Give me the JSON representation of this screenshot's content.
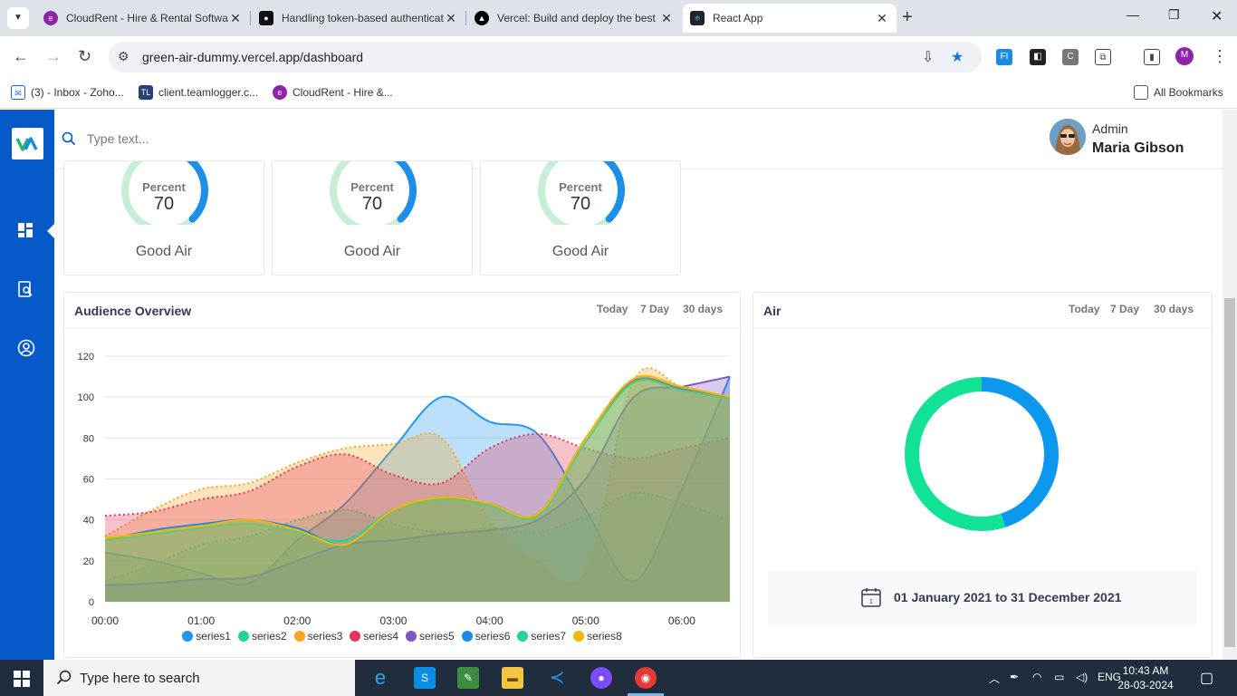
{
  "browser": {
    "tabs": [
      {
        "title": "CloudRent - Hire & Rental Software",
        "color": "#8e24aa"
      },
      {
        "title": "Handling token-based authentication",
        "color": "#111111"
      },
      {
        "title": "Vercel: Build and deploy the best",
        "color": "#000000"
      },
      {
        "title": "React App",
        "color": "#20232a"
      }
    ],
    "url": "green-air-dummy.vercel.app/dashboard",
    "bookmarks": [
      {
        "label": "(3) - Inbox - Zoho..."
      },
      {
        "label": "client.teamlogger.c..."
      },
      {
        "label": "CloudRent - Hire &..."
      }
    ],
    "all_bookmarks": "All Bookmarks",
    "profile_initial": "M"
  },
  "app": {
    "search_placeholder": "Type text...",
    "user": {
      "role": "Admin",
      "name": "Maria Gibson"
    },
    "gauges": [
      {
        "sub": "Percent",
        "value": "70",
        "label": "Good Air",
        "percent": 70
      },
      {
        "sub": "Percent",
        "value": "70",
        "label": "Good Air",
        "percent": 70
      },
      {
        "sub": "Percent",
        "value": "70",
        "label": "Good Air",
        "percent": 70
      }
    ],
    "audience": {
      "title": "Audience Overview",
      "ranges": [
        "Today",
        "7 Day",
        "30 days"
      ]
    },
    "air": {
      "title": "Air",
      "ranges": [
        "Today",
        "7 Day",
        "30 days"
      ],
      "date_range": "01 January 2021 to 31 December 2021"
    }
  },
  "chart_data": [
    {
      "type": "area",
      "ylim": [
        0,
        120
      ],
      "yticks": [
        "0",
        "20",
        "40",
        "60",
        "80",
        "100",
        "120"
      ],
      "xticks": [
        "00:00",
        "01:00",
        "02:00",
        "03:00",
        "04:00",
        "05:00",
        "06:00"
      ],
      "x": [
        0,
        0.5,
        1,
        1.5,
        2,
        2.5,
        3,
        3.5,
        4,
        4.5,
        5,
        5.5,
        6,
        6.5
      ],
      "series": [
        {
          "name": "series1",
          "color": "#2196f3",
          "dashed": false,
          "values": [
            24,
            20,
            14,
            9,
            30,
            48,
            75,
            100,
            88,
            82,
            45,
            10,
            55,
            110
          ]
        },
        {
          "name": "series2",
          "color": "#1ed68f",
          "dashed": true,
          "values": [
            10,
            18,
            28,
            32,
            40,
            45,
            38,
            34,
            36,
            34,
            42,
            53,
            48,
            40
          ]
        },
        {
          "name": "series3",
          "color": "#f5a623",
          "dashed": true,
          "values": [
            32,
            45,
            55,
            58,
            68,
            75,
            77,
            80,
            40,
            20,
            15,
            108,
            105,
            100
          ]
        },
        {
          "name": "series4",
          "color": "#e8345a",
          "dashed": true,
          "values": [
            42,
            44,
            50,
            54,
            66,
            72,
            62,
            58,
            75,
            82,
            75,
            70,
            75,
            80
          ]
        },
        {
          "name": "series5",
          "color": "#7e57c2",
          "dashed": false,
          "values": [
            8,
            9,
            11,
            12,
            20,
            28,
            30,
            33,
            35,
            40,
            60,
            100,
            105,
            110
          ]
        },
        {
          "name": "series6",
          "color": "#1e88e5",
          "dashed": false,
          "values": [
            30,
            35,
            38,
            40,
            36,
            28,
            45,
            50,
            48,
            43,
            80,
            108,
            104,
            100
          ]
        },
        {
          "name": "series7",
          "color": "#26d3a0",
          "dashed": false,
          "values": [
            30,
            33,
            36,
            38,
            34,
            30,
            45,
            50,
            47,
            42,
            78,
            107,
            103,
            99
          ]
        },
        {
          "name": "series8",
          "color": "#f5b500",
          "dashed": false,
          "values": [
            31,
            34,
            37,
            40,
            35,
            28,
            45,
            51,
            48,
            43,
            80,
            109,
            105,
            100
          ]
        }
      ]
    },
    {
      "type": "pie",
      "donut": true,
      "slices": [
        {
          "value": 45,
          "color": "#0d98f0"
        },
        {
          "value": 55,
          "color": "#11e296"
        }
      ]
    }
  ],
  "taskbar": {
    "search_placeholder": "Type here to search",
    "lang": "ENG",
    "time": "10:43 AM",
    "date": "28-03-2024"
  }
}
